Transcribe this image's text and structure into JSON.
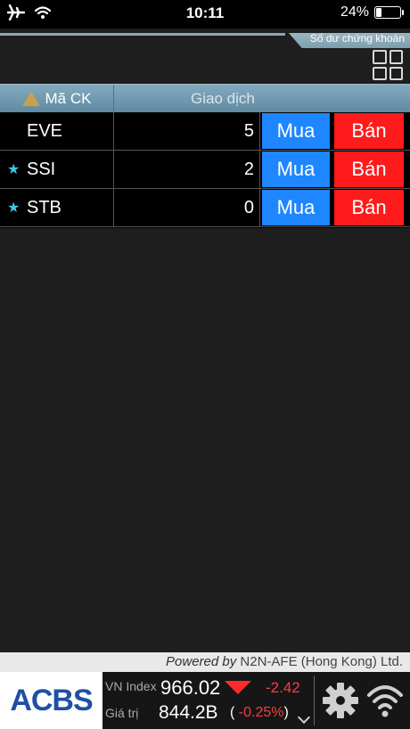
{
  "status_bar": {
    "time": "10:11",
    "battery": "24%",
    "battery_level": 0.24
  },
  "header": {
    "tab_label": "Số dư chứng khoán"
  },
  "table": {
    "col_code": "Mã CK",
    "col_trade": "Giao dịch",
    "rows": [
      {
        "code": "EVE",
        "starred": false,
        "qty": "5",
        "buy": "Mua",
        "sell": "Bán"
      },
      {
        "code": "SSI",
        "starred": true,
        "qty": "2",
        "buy": "Mua",
        "sell": "Bán"
      },
      {
        "code": "STB",
        "starred": true,
        "qty": "0",
        "buy": "Mua",
        "sell": "Bán"
      }
    ]
  },
  "powered": {
    "prefix": "Powered by",
    "company": "N2N-AFE (Hong Kong) Ltd."
  },
  "footer": {
    "logo": "ACBS",
    "index_label": "VN Index",
    "index_value": "966.02",
    "index_change": "-2.42",
    "value_label": "Giá trị",
    "value_amount": "844.2B",
    "value_pct_open": "(",
    "value_pct": "-0.25%",
    "value_pct_close": ")"
  },
  "colors": {
    "buy": "#1e86ff",
    "sell": "#ff1b1b",
    "down": "#ff2a2a",
    "star": "#3fc6e8"
  }
}
